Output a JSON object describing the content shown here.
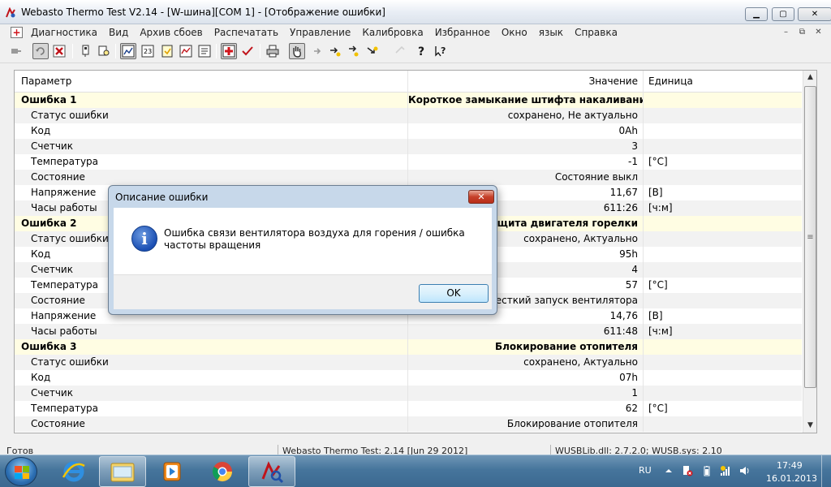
{
  "window": {
    "title": "Webasto Thermo Test V2.14 - [W-шина][COM 1] - [Отображение ошибки]",
    "minimize": "▁",
    "maximize": "▢",
    "close": "✕"
  },
  "menu": {
    "items": [
      "Диагностика",
      "Вид",
      "Архив сбоев",
      "Распечатать",
      "Управление",
      "Калибровка",
      "Избранное",
      "Окно",
      "язык",
      "Справка"
    ],
    "mdi_minimize": "–",
    "mdi_restore": "⧉",
    "mdi_close": "✕"
  },
  "table": {
    "headers": [
      "Параметр",
      "Значение",
      "Единица"
    ],
    "rows": [
      {
        "type": "group",
        "param": "Ошибка 1",
        "value": "Короткое замыкание штифта накаливания / д...",
        "unit": ""
      },
      {
        "type": "item",
        "param": "Статус ошибки",
        "value": "сохранено, Не актуально",
        "unit": ""
      },
      {
        "type": "item",
        "param": "Код",
        "value": "0Ah",
        "unit": ""
      },
      {
        "type": "item",
        "param": "Счетчик",
        "value": "3",
        "unit": ""
      },
      {
        "type": "item",
        "param": "Температура",
        "value": "-1",
        "unit": "[°C]"
      },
      {
        "type": "item",
        "param": "Состояние",
        "value": "Состояние выкл",
        "unit": ""
      },
      {
        "type": "item",
        "param": "Напряжение",
        "value": "11,67",
        "unit": "[В]"
      },
      {
        "type": "item",
        "param": "Часы работы",
        "value": "611:26",
        "unit": "[ч:м]"
      },
      {
        "type": "group",
        "param": "Ошибка 2",
        "value": "Защита двигателя горелки",
        "unit": ""
      },
      {
        "type": "item",
        "param": "Статус ошибки",
        "value": "сохранено, Актуально",
        "unit": ""
      },
      {
        "type": "item",
        "param": "Код",
        "value": "95h",
        "unit": ""
      },
      {
        "type": "item",
        "param": "Счетчик",
        "value": "4",
        "unit": ""
      },
      {
        "type": "item",
        "param": "Температура",
        "value": "57",
        "unit": "[°C]"
      },
      {
        "type": "item",
        "param": "Состояние",
        "value": "Жесткий запуск вентилятора",
        "unit": ""
      },
      {
        "type": "item",
        "param": "Напряжение",
        "value": "14,76",
        "unit": "[В]"
      },
      {
        "type": "item",
        "param": "Часы работы",
        "value": "611:48",
        "unit": "[ч:м]"
      },
      {
        "type": "group",
        "param": "Ошибка 3",
        "value": "Блокирование отопителя",
        "unit": ""
      },
      {
        "type": "item",
        "param": "Статус ошибки",
        "value": "сохранено, Актуально",
        "unit": ""
      },
      {
        "type": "item",
        "param": "Код",
        "value": "07h",
        "unit": ""
      },
      {
        "type": "item",
        "param": "Счетчик",
        "value": "1",
        "unit": ""
      },
      {
        "type": "item",
        "param": "Температура",
        "value": "62",
        "unit": "[°C]"
      },
      {
        "type": "item",
        "param": "Состояние",
        "value": "Блокирование отопителя",
        "unit": ""
      }
    ]
  },
  "statusbar": {
    "state": "Готов",
    "version": "Webasto Thermo Test: 2.14 [Jun 29 2012]",
    "lib": "WUSBLib.dll: 2.7.2.0; WUSB.sys: 2.10"
  },
  "dialog": {
    "title": "Описание ошибки",
    "message": "Ошибка связи вентилятора воздуха для горения / ошибка частоты вращения",
    "ok": "OK",
    "close": "✕"
  },
  "taskbar": {
    "language": "RU",
    "time": "17:49",
    "date": "16.01.2013"
  },
  "colors": {
    "group_row": "#fffde3",
    "alt_row": "#f2f2f2",
    "taskbar": "#46759c",
    "dialog_frame": "#c7d8ea"
  }
}
